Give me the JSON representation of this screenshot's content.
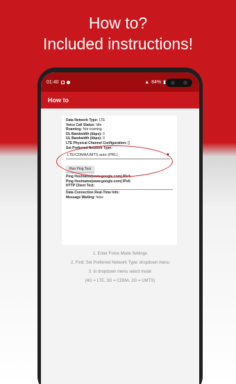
{
  "headline": {
    "line1": "How to?",
    "line2": "Included instructions!"
  },
  "statusbar": {
    "time": "01:40",
    "battery": "84%"
  },
  "appbar": {
    "title": "How to"
  },
  "info": {
    "data_network_label": "Data Network Type:",
    "data_network_value": "LTE",
    "voice_call_label": "Voice Call Status:",
    "voice_call_value": "Idle",
    "roaming_label": "Roaming:",
    "roaming_value": "Not roaming",
    "dl_bw_label": "DL Bandwidth (kbps):",
    "dl_bw_value": "0",
    "ul_bw_label": "UL Bandwidth (kbps):",
    "ul_bw_value": "0",
    "lte_phys_label": "LTE Physical Channel Configuration:",
    "lte_phys_value": "[]",
    "preferred_label": "Set Preferred Network Type:",
    "preferred_value": "LTE/CDMA/UMTS auto (PRL)",
    "ping_button": "Run Ping Test",
    "ping_v4_label": "Ping Hostname(www.google.com) IPv4:",
    "ping_v6_label": "Ping Hostname(www.google.com) IPv6:",
    "http_label": "HTTP Client Test:",
    "realtime_label": "Data Connection Real-Time Info:",
    "msg_waiting_label": "Message Waiting:",
    "msg_waiting_value": "false"
  },
  "instructions": {
    "step1": "1. Enter Force Mode Settings",
    "step2": "2. Find: Set Preferred Network Type: dropdown menu",
    "step3": "3. In dropdown menu select mode",
    "step4": "(4G = LTE, 3G = CDMA, 2G = UMTS)"
  },
  "colors": {
    "brand_red": "#c8181e",
    "status_red": "#9e0c10",
    "highlight_red": "#d2232a"
  }
}
